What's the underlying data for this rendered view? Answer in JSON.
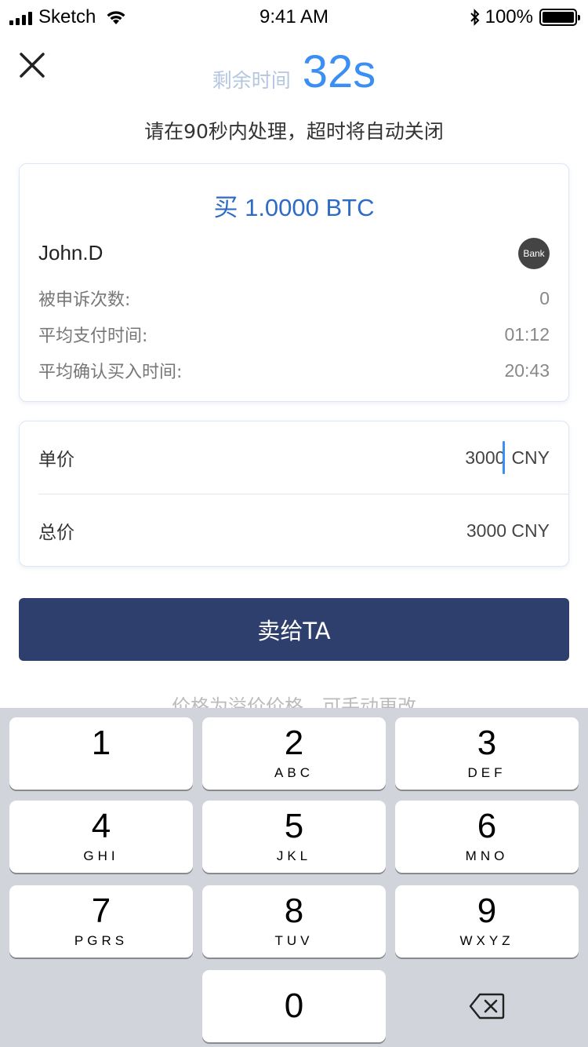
{
  "status_bar": {
    "carrier": "Sketch",
    "time": "9:41 AM",
    "battery": "100%"
  },
  "header": {
    "timer_label": "剩余时间",
    "timer_value": "32s",
    "subtitle": "请在90秒内处理，超时将自动关闭"
  },
  "order": {
    "title": "买 1.0000 BTC",
    "user": "John.D",
    "badge": "Bank",
    "stats": [
      {
        "label": "被申诉次数:",
        "value": "0"
      },
      {
        "label": "平均支付时间:",
        "value": "01:12"
      },
      {
        "label": "平均确认买入时间:",
        "value": "20:43"
      }
    ]
  },
  "price": {
    "unit_label": "单价",
    "unit_value": "3000",
    "unit_currency": "CNY",
    "total_label": "总价",
    "total_value": "3000 CNY"
  },
  "action": {
    "sell_label": "卖给TA",
    "hint": "价格为溢价价格，可手动更改"
  },
  "keypad": {
    "keys": [
      {
        "num": "1",
        "letters": ""
      },
      {
        "num": "2",
        "letters": "ABC"
      },
      {
        "num": "3",
        "letters": "DEF"
      },
      {
        "num": "4",
        "letters": "GHI"
      },
      {
        "num": "5",
        "letters": "JKL"
      },
      {
        "num": "6",
        "letters": "MNO"
      },
      {
        "num": "7",
        "letters": "PGRS"
      },
      {
        "num": "8",
        "letters": "TUV"
      },
      {
        "num": "9",
        "letters": "WXYZ"
      },
      {
        "num": "0",
        "letters": ""
      }
    ],
    "delete_icon": "backspace-icon"
  },
  "colors": {
    "accent": "#3b8ff3",
    "primary_button": "#2f3f6d",
    "title_blue": "#2d6bc4"
  }
}
